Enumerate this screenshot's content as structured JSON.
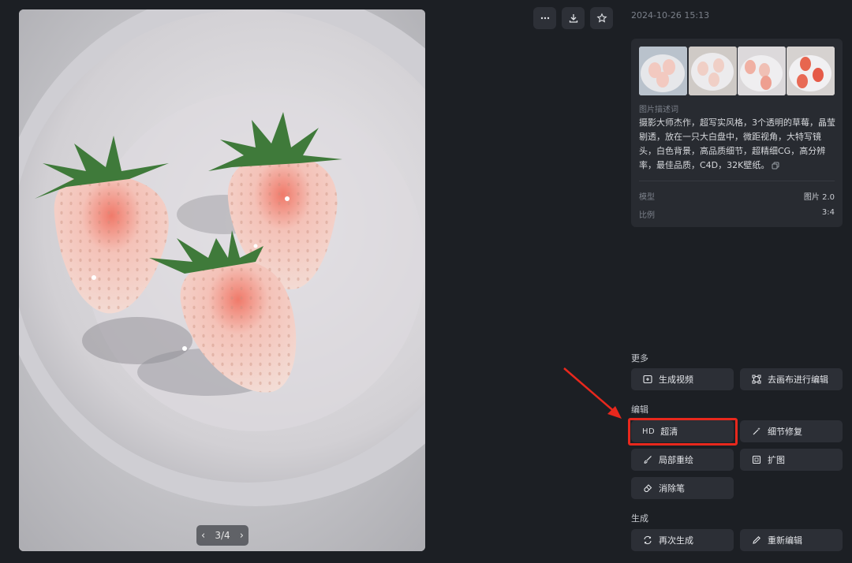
{
  "viewer": {
    "pager_text": "3/4",
    "prev_icon": "chevron-left-icon",
    "next_icon": "chevron-right-icon"
  },
  "toolbar": {
    "more_icon": "more-dots-icon",
    "download_icon": "download-icon",
    "favorite_icon": "star-icon"
  },
  "timestamp": "2024-10-26 15:13",
  "info": {
    "thumbnails_count": 4,
    "description_label": "图片描述词",
    "description": "摄影大师杰作，超写实风格，3个透明的草莓，晶莹剔透，放在一只大白盘中，微距视角，大特写镜头，白色背景，高品质细节，超精细CG，高分辨率，最佳品质，C4D，32K壁纸。",
    "model_label": "模型",
    "model_value": "图片 2.0",
    "ratio_label": "比例",
    "ratio_value": "3:4"
  },
  "sections": {
    "more_title": "更多",
    "generate_video": "生成视频",
    "canvas_edit": "去画布进行编辑",
    "edit_title": "编辑",
    "hd_glyph": "HD",
    "upscale": "超清",
    "detail_fix": "细节修复",
    "inpaint": "局部重绘",
    "outpaint": "扩图",
    "eraser": "消除笔",
    "generate_title": "生成",
    "regenerate": "再次生成",
    "re_edit": "重新编辑"
  },
  "colors": {
    "background": "#1c1f24",
    "panel": "#282b31",
    "button": "#2c2f36",
    "highlight": "#e8281d",
    "muted_text": "#7b808a"
  }
}
